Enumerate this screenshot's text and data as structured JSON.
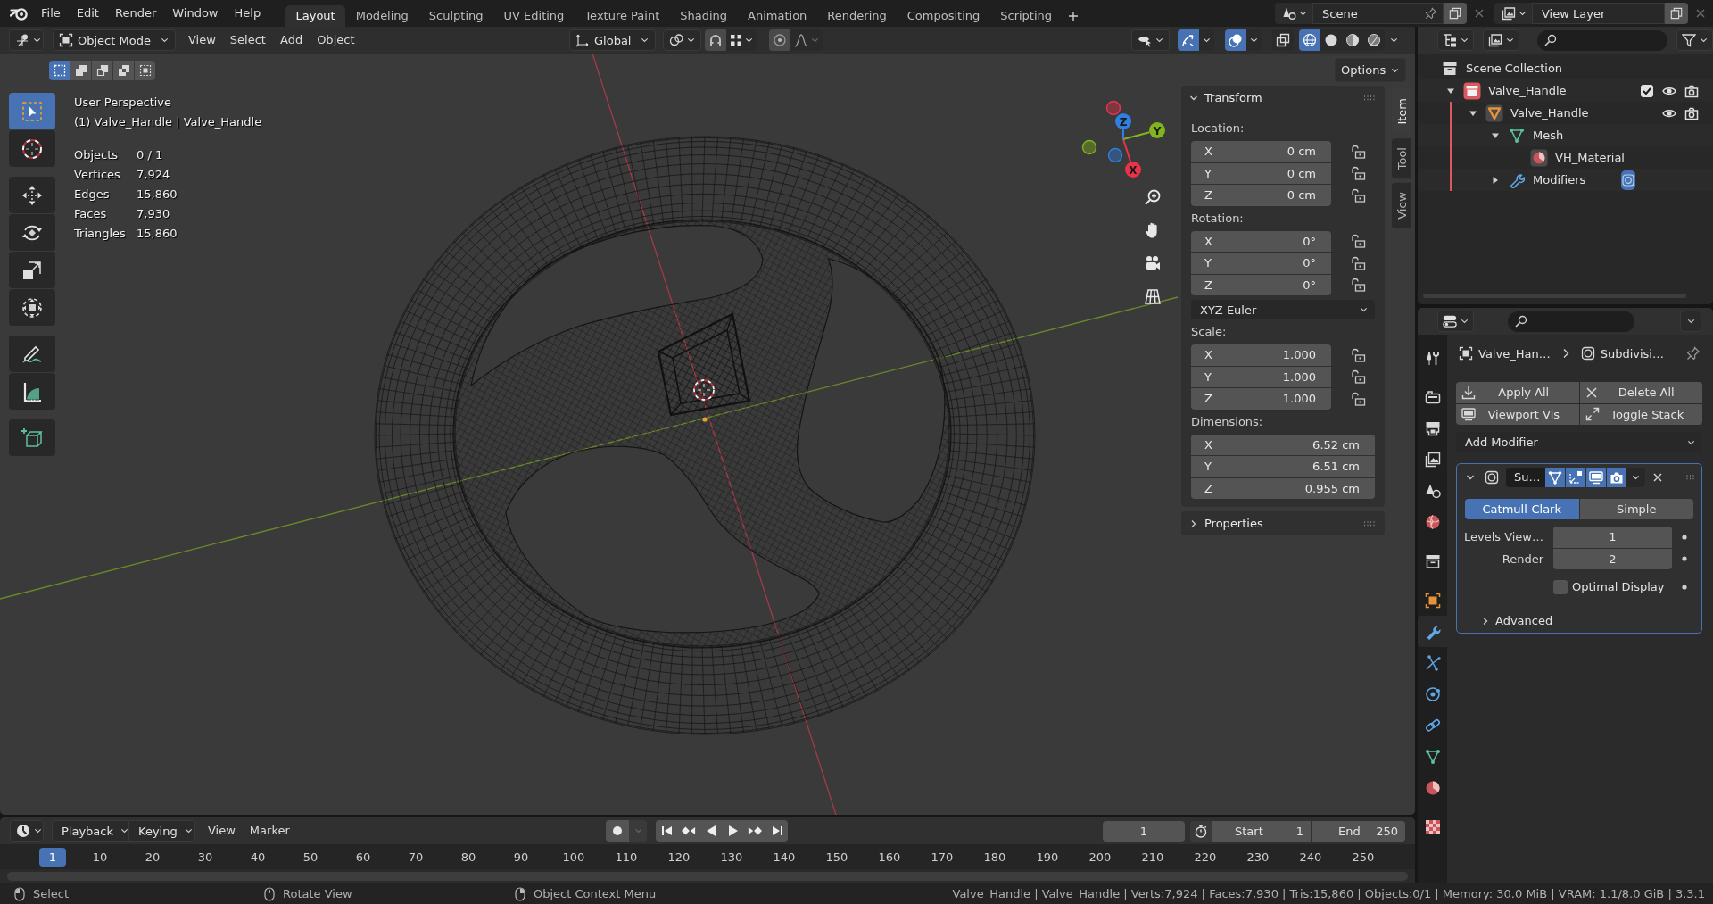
{
  "top_bar": {
    "menus": [
      "File",
      "Edit",
      "Render",
      "Window",
      "Help"
    ],
    "workspaces": [
      {
        "label": "Layout",
        "selected": true
      },
      {
        "label": "Modeling",
        "selected": false
      },
      {
        "label": "Sculpting",
        "selected": false
      },
      {
        "label": "UV Editing",
        "selected": false
      },
      {
        "label": "Texture Paint",
        "selected": false
      },
      {
        "label": "Shading",
        "selected": false
      },
      {
        "label": "Animation",
        "selected": false
      },
      {
        "label": "Rendering",
        "selected": false
      },
      {
        "label": "Compositing",
        "selected": false
      },
      {
        "label": "Scripting",
        "selected": false
      }
    ],
    "scene": "Scene",
    "view_layer": "View Layer"
  },
  "viewport": {
    "mode": "Object Mode",
    "menus": [
      "View",
      "Select",
      "Add",
      "Object"
    ],
    "orientation": "Global",
    "gizmos": {
      "on": true
    },
    "overlays": {
      "on": true
    },
    "shading": [
      {
        "kind": "wireframe",
        "selected": true
      },
      {
        "kind": "solid",
        "selected": false
      },
      {
        "kind": "material",
        "selected": false
      },
      {
        "kind": "rendered",
        "selected": false
      }
    ],
    "select_modes": [
      {
        "kind": "set",
        "selected": true
      },
      {
        "kind": "extend",
        "selected": false
      },
      {
        "kind": "subtract",
        "selected": false
      },
      {
        "kind": "invert",
        "selected": false
      },
      {
        "kind": "intersect",
        "selected": false
      }
    ],
    "options": "Options",
    "tools": [
      {
        "kind": "select",
        "selected": true
      },
      {
        "kind": "cursor",
        "selected": false
      },
      {
        "kind": "move",
        "selected": false
      },
      {
        "kind": "rotate",
        "selected": false
      },
      {
        "kind": "scale",
        "selected": false
      },
      {
        "kind": "transform",
        "selected": false
      },
      {
        "kind": "annotate",
        "selected": false
      },
      {
        "kind": "measure",
        "selected": false
      },
      {
        "kind": "add",
        "selected": false
      }
    ],
    "view_name": "User Perspective",
    "object_info": "(1) Valve_Handle | Valve_Handle",
    "stats": [
      {
        "label": "Objects",
        "value": "0 / 1"
      },
      {
        "label": "Vertices",
        "value": "7,924"
      },
      {
        "label": "Edges",
        "value": "15,860"
      },
      {
        "label": "Faces",
        "value": "7,930"
      },
      {
        "label": "Triangles",
        "value": "15,860"
      }
    ],
    "axes": [
      {
        "label": "X",
        "color": "#e8334b"
      },
      {
        "label": "Y",
        "color": "#82b51c"
      },
      {
        "label": "Z",
        "color": "#2f80e0"
      }
    ]
  },
  "sidebar": {
    "tabs": [
      {
        "label": "Item",
        "selected": true
      },
      {
        "label": "Tool",
        "selected": false
      },
      {
        "label": "View",
        "selected": false
      }
    ],
    "transform": {
      "title": "Transform",
      "expanded": true,
      "groups": [
        {
          "label": "Location:",
          "fields": [
            {
              "axis": "X",
              "value": "0 cm",
              "locked": false
            },
            {
              "axis": "Y",
              "value": "0 cm",
              "locked": false
            },
            {
              "axis": "Z",
              "value": "0 cm",
              "locked": false
            }
          ]
        },
        {
          "label": "Rotation:",
          "fields": [
            {
              "axis": "X",
              "value": "0°",
              "locked": false
            },
            {
              "axis": "Y",
              "value": "0°",
              "locked": false
            },
            {
              "axis": "Z",
              "value": "0°",
              "locked": false
            }
          ],
          "mode": "XYZ Euler"
        },
        {
          "label": "Scale:",
          "fields": [
            {
              "axis": "X",
              "value": "1.000",
              "locked": false
            },
            {
              "axis": "Y",
              "value": "1.000",
              "locked": false
            },
            {
              "axis": "Z",
              "value": "1.000",
              "locked": false
            }
          ]
        },
        {
          "label": "Dimensions:",
          "fields": [
            {
              "axis": "X",
              "value": "6.52 cm"
            },
            {
              "axis": "Y",
              "value": "6.51 cm"
            },
            {
              "axis": "Z",
              "value": "0.955 cm"
            }
          ]
        }
      ]
    },
    "properties": {
      "title": "Properties",
      "expanded": false
    }
  },
  "outliner": {
    "tree": [
      {
        "label": "Scene Collection",
        "kind": "scene",
        "children": [
          {
            "label": "Valve_Handle",
            "kind": "collection",
            "color": "#d9595f",
            "expanded": true,
            "checked": true,
            "visible": true,
            "renderable": true,
            "children": [
              {
                "label": "Valve_Handle",
                "kind": "object",
                "expanded": true,
                "visible": true,
                "renderable": true,
                "children": [
                  {
                    "label": "Mesh",
                    "kind": "mesh",
                    "expanded": true,
                    "children": [
                      {
                        "label": "VH_Material",
                        "kind": "material"
                      }
                    ]
                  },
                  {
                    "label": "Modifiers",
                    "kind": "modifiers",
                    "expanded": false
                  }
                ]
              }
            ]
          }
        ]
      }
    ]
  },
  "properties_editor": {
    "tabs": [
      {
        "kind": "tool",
        "selected": false
      },
      {
        "kind": "render",
        "selected": false
      },
      {
        "kind": "output",
        "selected": false
      },
      {
        "kind": "viewlayer",
        "selected": false
      },
      {
        "kind": "scene",
        "selected": false
      },
      {
        "kind": "world",
        "selected": false
      },
      {
        "kind": "collection",
        "selected": false
      },
      {
        "kind": "object",
        "selected": false
      },
      {
        "kind": "modifiers",
        "selected": true
      },
      {
        "kind": "particles",
        "selected": false
      },
      {
        "kind": "physics",
        "selected": false
      },
      {
        "kind": "constraints",
        "selected": false
      },
      {
        "kind": "data",
        "selected": false
      },
      {
        "kind": "material",
        "selected": false
      },
      {
        "kind": "texture",
        "selected": false
      }
    ],
    "breadcrumb": [
      "Valve_Han…",
      "Subdivisi…"
    ],
    "actions": [
      {
        "kind": "apply",
        "label": "Apply All"
      },
      {
        "kind": "delete",
        "label": "Delete All"
      },
      {
        "kind": "viewport",
        "label": "Viewport Vis"
      },
      {
        "kind": "stack",
        "label": "Toggle Stack"
      }
    ],
    "add_modifier": "Add Modifier",
    "modifier": {
      "name": "Su…",
      "expanded": true,
      "toggles": [
        {
          "kind": "editmode",
          "on": true
        },
        {
          "kind": "cage",
          "on": true
        },
        {
          "kind": "viewport",
          "on": true
        },
        {
          "kind": "render",
          "on": true
        }
      ],
      "types": [
        {
          "label": "Catmull-Clark",
          "selected": true
        },
        {
          "label": "Simple",
          "selected": false
        }
      ],
      "levels": [
        {
          "label": "Levels View…",
          "value": "1"
        },
        {
          "label": "Render",
          "value": "2"
        }
      ],
      "optimal_display": {
        "label": "Optimal Display",
        "checked": false
      },
      "advanced": {
        "label": "Advanced",
        "expanded": false
      }
    }
  },
  "timeline": {
    "dropdowns": [
      "Playback",
      "Keying"
    ],
    "menus": [
      "View",
      "Marker"
    ],
    "current_frame": "1",
    "start": {
      "label": "Start",
      "value": "1"
    },
    "end": {
      "label": "End",
      "value": "250"
    },
    "playhead": "1",
    "ruler": [
      "10",
      "20",
      "30",
      "40",
      "50",
      "60",
      "70",
      "80",
      "90",
      "100",
      "110",
      "120",
      "130",
      "140",
      "150",
      "160",
      "170",
      "180",
      "190",
      "200",
      "210",
      "220",
      "230",
      "240",
      "250"
    ]
  },
  "status_bar": {
    "hints": [
      {
        "kind": "left",
        "label": "Select"
      },
      {
        "kind": "middle",
        "label": "Rotate View"
      },
      {
        "kind": "right",
        "label": "Object Context Menu"
      }
    ],
    "info": "Valve_Handle | Valve_Handle | Verts:7,924 | Faces:7,930 | Tris:15,860 | Objects:0/1 | Memory: 30.0 MiB | VRAM: 1.1/8.0 GiB | 3.3.1"
  }
}
